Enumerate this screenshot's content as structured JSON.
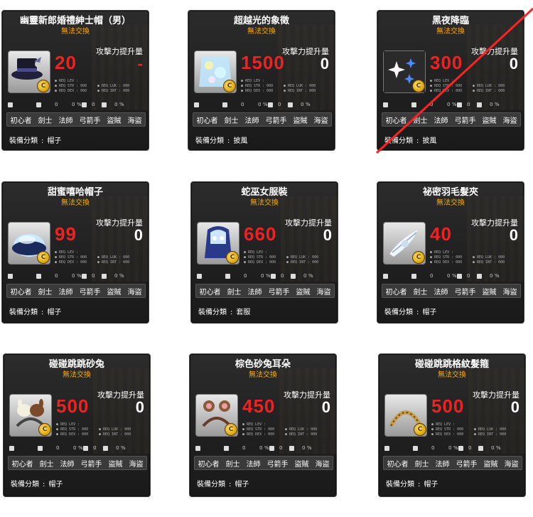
{
  "labels": {
    "untradable": "無法交換",
    "atk_label": "攻擊力提升量",
    "category_label": "裝備分類",
    "category_sep": ":",
    "req_lev": "● REQ LEV :",
    "req_str": "● REQ STR : 000",
    "req_dex": "● REQ DEX : 000",
    "req_luk": "● REQ LUK : 000",
    "req_int": "● REQ INT : 000",
    "stat_values": [
      "0",
      "0",
      "0",
      "0"
    ],
    "stat_pct": [
      "%",
      "%"
    ],
    "jobs": [
      "初心者",
      "劍士",
      "法師",
      "弓箭手",
      "盜賊",
      "海盜"
    ]
  },
  "colors": {
    "power_red": "#ee2222",
    "untradable_orange": "#ffaa00",
    "strike_red": "#ff2222"
  },
  "cards": [
    {
      "name": "幽靈新郎婚禮紳士帽（男）",
      "power": "20",
      "delta": "-",
      "category": "帽子",
      "icon": "ghost-top-hat-icon",
      "struck": false
    },
    {
      "name": "超越光的象徵",
      "power": "1500",
      "delta": "0",
      "category": "披風",
      "icon": "light-cape-icon",
      "struck": false
    },
    {
      "name": "黑夜降臨",
      "power": "300",
      "delta": "0",
      "category": "披風",
      "icon": "dark-sparkle-cape-icon",
      "struck": true
    },
    {
      "name": "甜蜜嘻哈帽子",
      "power": "99",
      "delta": "0",
      "category": "帽子",
      "icon": "hiphop-cap-icon",
      "struck": false
    },
    {
      "name": "蛇巫女服裝",
      "power": "660",
      "delta": "0",
      "category": "套服",
      "icon": "snake-shrine-outfit-icon",
      "struck": false
    },
    {
      "name": "祕密羽毛髮夾",
      "power": "40",
      "delta": "0",
      "category": "帽子",
      "icon": "feather-hairpin-icon",
      "struck": false
    },
    {
      "name": "碰碰跳跳砂兔",
      "power": "500",
      "delta": "0",
      "category": "帽子",
      "icon": "bunny-headband-icon",
      "struck": false
    },
    {
      "name": "棕色砂兔耳朵",
      "power": "450",
      "delta": "0",
      "category": "帽子",
      "icon": "brown-bunny-ears-icon",
      "struck": false
    },
    {
      "name": "碰碰跳跳格紋髮箍",
      "power": "500",
      "delta": "0",
      "category": "帽子",
      "icon": "plaid-headband-icon",
      "struck": false
    }
  ]
}
